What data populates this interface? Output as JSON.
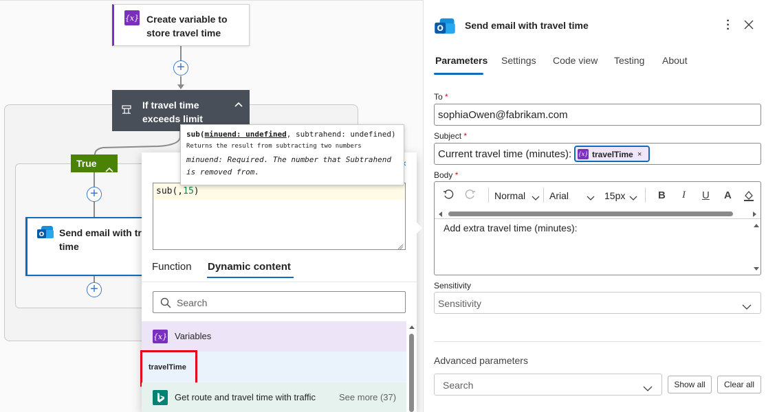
{
  "canvas": {
    "create_var_title": "Create variable to",
    "create_var_title2": "store travel time",
    "condition_title": "If travel time",
    "condition_title2": "exceeds limit",
    "true_label": "True",
    "send_card_title": "Send email with tra",
    "send_card_title2": "time"
  },
  "tooltip": {
    "fn_name": "sub(",
    "param1": "minuend: undefined",
    "rest": ", subtrahend: undefined)",
    "desc": "Returns the result from subtracting two numbers",
    "param_desc": "minuend: Required. The number that Subtrahend",
    "param_desc2": "is removed from."
  },
  "expression": {
    "text_prefix": "sub(,",
    "text_num": "15",
    "text_suffix": ")"
  },
  "popup_tabs": {
    "function": "Function",
    "dynamic": "Dynamic content"
  },
  "popup_search": {
    "placeholder": "Search"
  },
  "popup_list": {
    "section": "Variables",
    "item": "travelTime",
    "group": "Get route and travel time with traffic",
    "see_more": "See more (37)"
  },
  "panel": {
    "title": "Send email with travel time",
    "tabs": [
      "Parameters",
      "Settings",
      "Code view",
      "Testing",
      "About"
    ],
    "to_label": "To",
    "to_value": "sophiaOwen@fabrikam.com",
    "subject_label": "Subject",
    "subject_text": "Current travel time (minutes):",
    "subject_token": "travelTime",
    "body_label": "Body",
    "toolbar": {
      "format": "Normal",
      "font": "Arial",
      "size": "15px"
    },
    "body_text": "Add extra travel time (minutes):",
    "sensitivity_label": "Sensitivity",
    "sensitivity_placeholder": "Sensitivity",
    "advanced_label": "Advanced parameters",
    "advanced_placeholder": "Search",
    "show_all": "Show all",
    "clear_all": "Clear all"
  },
  "colors": {
    "accent": "#0f6cbd",
    "variable": "#7a2fbf",
    "true_green": "#498205",
    "condition": "#484f59",
    "highlight_red": "#e0001b"
  }
}
